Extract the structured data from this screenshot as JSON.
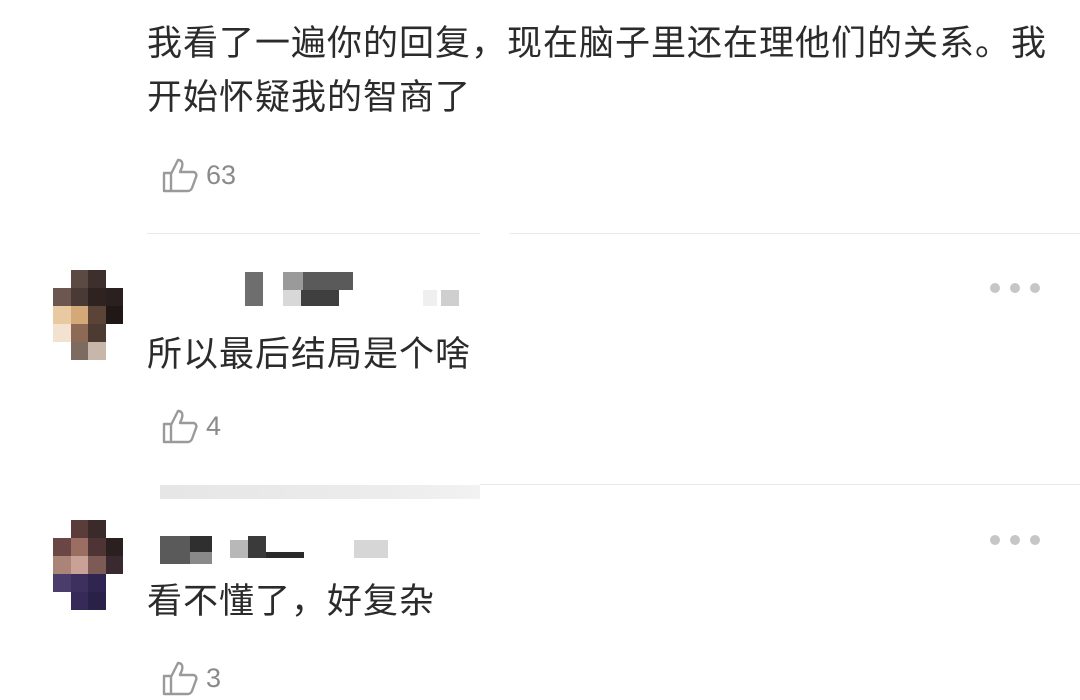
{
  "comments": [
    {
      "text": "我看了一遍你的回复，现在脑子里还在理他们的关系。我开始怀疑我的智商了",
      "likes": "63",
      "like_icon": "thumbs-up-outline-icon"
    },
    {
      "text": "所以最后结局是个啥",
      "likes": "4",
      "like_icon": "thumbs-up-outline-icon",
      "more_icon": "more-dots-icon"
    },
    {
      "text": "看不懂了，好复杂",
      "likes": "3",
      "like_icon": "thumbs-up-outline-icon",
      "more_icon": "more-dots-icon"
    }
  ],
  "colors": {
    "text": "#2b2b2b",
    "muted": "#8a8a8a",
    "divider": "#e9e9e9",
    "dots": "#c6c6c6"
  }
}
